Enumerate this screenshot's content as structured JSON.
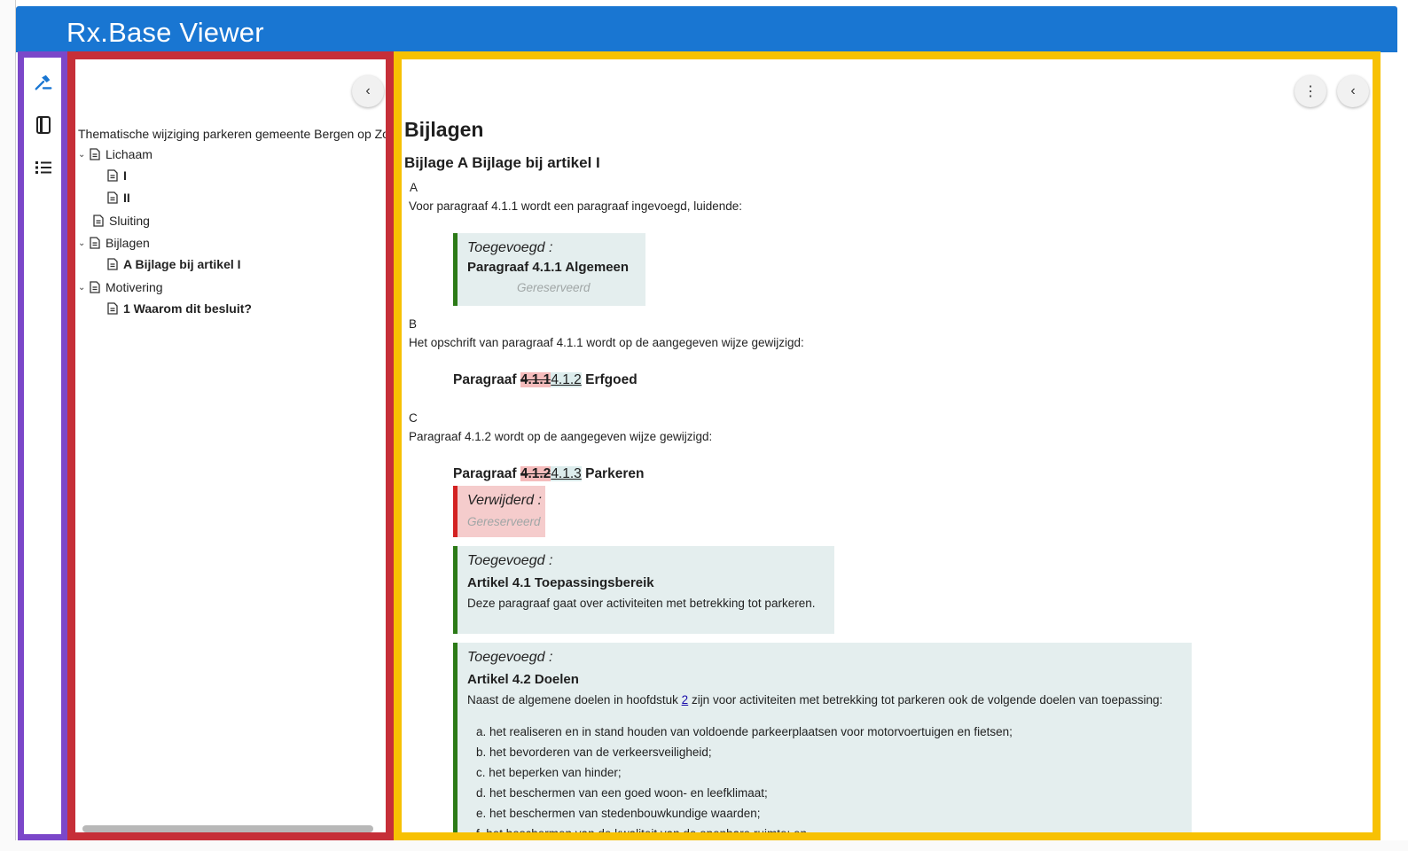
{
  "app": {
    "title": "Rx.Base Viewer"
  },
  "rail": [
    {
      "icon": "gavel-icon",
      "active": true
    },
    {
      "icon": "book-icon",
      "active": false
    },
    {
      "icon": "list-icon",
      "active": false
    }
  ],
  "tree": {
    "collapse_label": "‹",
    "root": "Thematische wijziging parkeren gemeente Bergen op Zoom",
    "items": [
      {
        "label": "Lichaam",
        "expanded": true
      },
      {
        "label": "I"
      },
      {
        "label": "II"
      },
      {
        "label": "Sluiting"
      },
      {
        "label": "Bijlagen",
        "expanded": true
      },
      {
        "label": "A Bijlage bij artikel I"
      },
      {
        "label": "Motivering",
        "expanded": true
      },
      {
        "label": "1 Waarom dit besluit?"
      }
    ]
  },
  "content": {
    "menu_label": "⋮",
    "collapse_label": "‹",
    "heading": "Bijlagen",
    "subheading": "Bijlage A Bijlage bij artikel I",
    "section_a": {
      "letter": "A",
      "intro": "Voor paragraaf 4.1.1 wordt een paragraaf ingevoegd, luidende:",
      "box": {
        "label": "Toegevoegd :",
        "title": "Paragraaf 4.1.1 Algemeen",
        "reserved": "Gereserveerd"
      }
    },
    "section_b": {
      "letter": "B",
      "intro": "Het opschrift van paragraaf 4.1.1 wordt op de aangegeven wijze gewijzigd:",
      "prefix": "Paragraaf ",
      "deleted": "4.1.1",
      "inserted": "4.1.2",
      "suffix": " Erfgoed"
    },
    "section_c": {
      "letter": "C",
      "intro": "Paragraaf 4.1.2 wordt op de aangegeven wijze gewijzigd:",
      "prefix": "Paragraaf ",
      "deleted": "4.1.2",
      "inserted": "4.1.3",
      "suffix": " Parkeren",
      "removed_box": {
        "label": "Verwijderd :",
        "reserved": "Gereserveerd"
      },
      "box1": {
        "label": "Toegevoegd :",
        "title": "Artikel 4.1 Toepassingsbereik",
        "text": "Deze paragraaf gaat over activiteiten met betrekking tot parkeren."
      },
      "box2": {
        "label": "Toegevoegd :",
        "title": "Artikel 4.2 Doelen",
        "text_before": "Naast de algemene doelen in hoofdstuk ",
        "link": "2",
        "text_after": " zijn voor activiteiten met betrekking tot parkeren ook de volgende doelen van toepassing:",
        "list": [
          "a. het realiseren en in stand houden van voldoende parkeerplaatsen voor motorvoertuigen en fietsen;",
          "b. het bevorderen van de verkeersveiligheid;",
          "c. het beperken van hinder;",
          "d. het beschermen van een goed woon- en leefklimaat;",
          "e. het beschermen van stedenbouwkundige waarden;",
          "f. het beschermen van de kwaliteit van de openbare ruimte; en"
        ]
      }
    }
  }
}
